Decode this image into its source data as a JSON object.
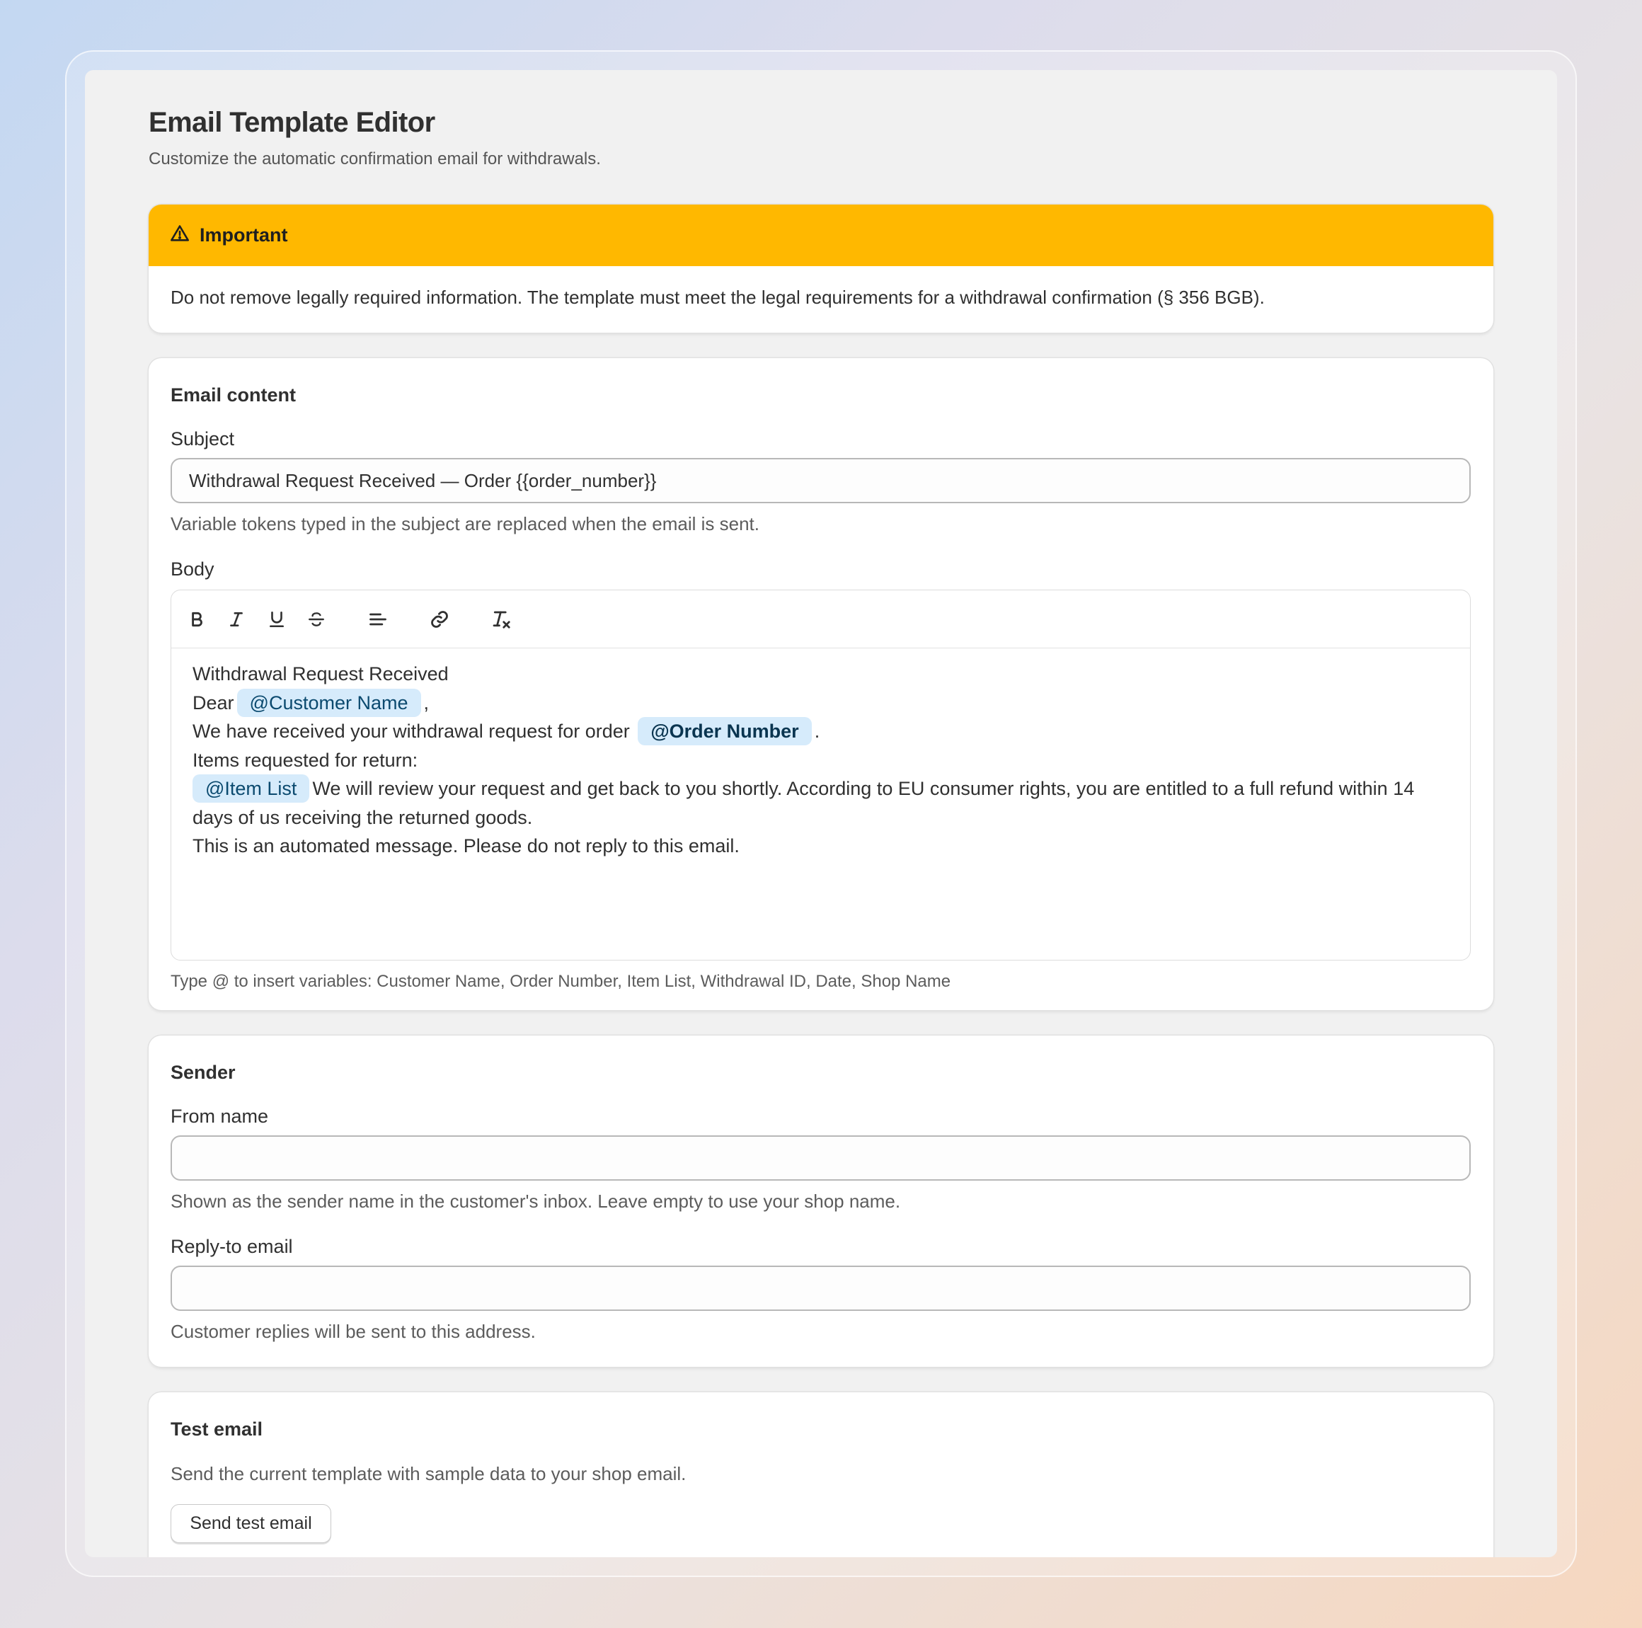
{
  "page": {
    "title": "Email Template Editor",
    "subtitle": "Customize the automatic confirmation email for withdrawals."
  },
  "banner": {
    "icon": "warning-triangle-icon",
    "color": "#ffb800",
    "title": "Important",
    "message": "Do not remove legally required information. The template must meet the legal requirements for a withdrawal confirmation (§ 356 BGB)."
  },
  "email_content": {
    "title": "Email content",
    "subject_label": "Subject",
    "subject_value": "Withdrawal Request Received — Order {{order_number}}",
    "subject_help": "Variable tokens typed in the subject are replaced when the email is sent.",
    "body_label": "Body",
    "toolbar": [
      "bold-icon",
      "italic-icon",
      "underline-icon",
      "strikethrough-icon",
      "align-left-icon",
      "link-icon",
      "clear-format-icon"
    ],
    "body": {
      "line1": "Withdrawal Request Received",
      "dear": "Dear",
      "chip_customer": "@Customer Name",
      "comma": ",",
      "received": "We have received your withdrawal request for order",
      "chip_order": "@Order Number",
      "period": ".",
      "items": "Items requested for return:",
      "chip_items": "@Item List",
      "review": "We will review your request and get back to you shortly. According to EU consumer rights, you are entitled to a full refund within 14 days of us receiving the returned goods.",
      "automated": "This is an automated message. Please do not reply to this email."
    },
    "body_help": "Type @ to insert variables: Customer Name, Order Number, Item List, Withdrawal ID, Date, Shop Name",
    "chip_color": "#d6ebfb"
  },
  "sender": {
    "title": "Sender",
    "from_label": "From name",
    "from_value": "",
    "from_help": "Shown as the sender name in the customer's inbox. Leave empty to use your shop name.",
    "reply_label": "Reply-to email",
    "reply_value": "",
    "reply_help": "Customer replies will be sent to this address."
  },
  "test_email": {
    "title": "Test email",
    "description": "Send the current template with sample data to your shop email.",
    "button": "Send test email"
  }
}
